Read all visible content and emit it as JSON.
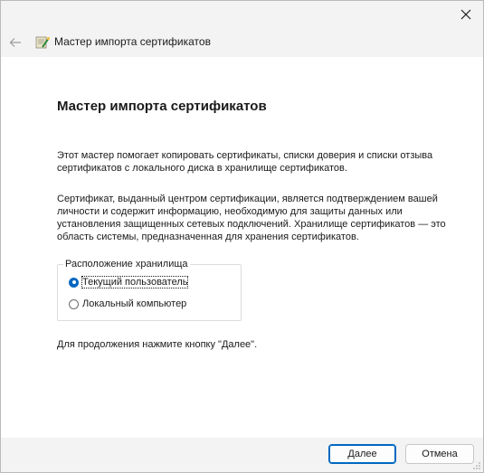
{
  "window": {
    "header_title": "Мастер импорта сертификатов"
  },
  "page": {
    "title": "Мастер импорта сертификатов",
    "paragraph1": "Этот мастер помогает копировать сертификаты, списки доверия и списки отзыва сертификатов с локального диска в хранилище сертификатов.",
    "paragraph2": "Сертификат, выданный центром сертификации, является подтверждением вашей личности и содержит информацию, необходимую для защиты данных или установления защищенных сетевых подключений. Хранилище сертификатов — это область системы, предназначенная для хранения сертификатов.",
    "store_group": {
      "legend": "Расположение хранилища",
      "options": [
        {
          "label": "Текущий пользователь",
          "selected": true
        },
        {
          "label": "Локальный компьютер",
          "selected": false
        }
      ]
    },
    "continue_text": "Для продолжения нажмите кнопку \"Далее\"."
  },
  "footer": {
    "next_label": "Далее",
    "cancel_label": "Отмена"
  },
  "icons": {
    "close": "close-icon",
    "back": "back-arrow-icon",
    "wizard": "certificate-wizard-icon"
  },
  "colors": {
    "accent": "#0067c0",
    "content_bg": "#ffffff",
    "chrome_bg": "#f3f3f3"
  }
}
